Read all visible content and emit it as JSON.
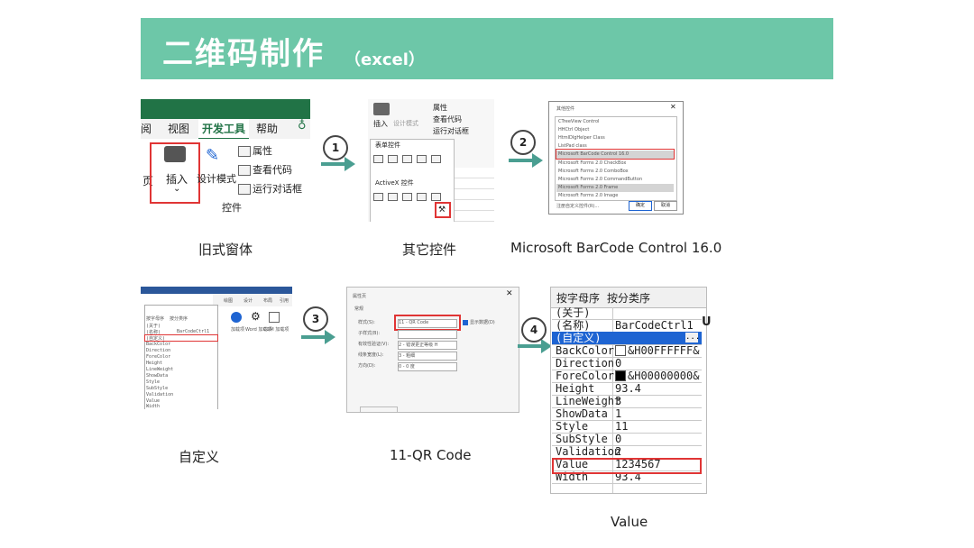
{
  "header": {
    "title": "二维码制作",
    "subtitle": "（excel）"
  },
  "captions": {
    "c1": "旧式窗体",
    "c2": "其它控件",
    "c3": "Microsoft BarCode Control 16.0",
    "c4": "自定义",
    "c5": "11-QR Code",
    "c6": "Value"
  },
  "steps": {
    "s1": "1",
    "s2": "2",
    "s3": "3",
    "s4": "4"
  },
  "ribbon": {
    "tab_view": "视图",
    "tab_dev": "开发工具",
    "tab_help": "帮助",
    "insert_label": "插入",
    "design_mode": "设计模式",
    "properties": "属性",
    "view_code": "查看代码",
    "run_dialog": "运行对话框",
    "group_controls": "控件",
    "left_label": "页"
  },
  "insert_menu": {
    "insert": "插入",
    "design": "设计模式",
    "properties": "属性",
    "view_code": "查看代码",
    "run_dialog": "运行对话框",
    "form_controls": "表单控件",
    "activex_controls": "ActiveX 控件"
  },
  "more_controls": {
    "title": "其他控件",
    "items": [
      "CTreeView Control",
      "HHCtrl Object",
      "HtmlDlgHelper Class",
      "ListPad class",
      "Microsoft BarCode Control 16.0",
      "Microsoft Forms 2.0 CheckBox",
      "Microsoft Forms 2.0 ComboBox",
      "Microsoft Forms 2.0 CommandButton",
      "Microsoft Forms 2.0 Frame",
      "Microsoft Forms 2.0 Image"
    ],
    "register": "注册自定义控件(R)...",
    "ok": "确定",
    "cancel": "取消"
  },
  "custom_shot": {
    "tabs": [
      "按字母序",
      "按分类序"
    ],
    "rows": [
      "(关于)",
      "(名称)",
      "(自定义)",
      "BackColor",
      "Direction",
      "ForeColor",
      "Height",
      "LineWeight",
      "ShowData",
      "Style",
      "SubStyle",
      "Validation",
      "Value",
      "Width"
    ],
    "name_value": "BarCodeCtrl1",
    "ribbon": [
      "绘图",
      "设计",
      "布局",
      "引用"
    ],
    "addins": [
      "加载项",
      "Word 加载项",
      "COM 加载项"
    ]
  },
  "qr_dialog": {
    "title": "属性页",
    "tab": "常规",
    "fields": [
      "样式(S):",
      "子样式(B):",
      "有效性验证(V):",
      "线条宽度(L):",
      "方向(D):"
    ],
    "values": [
      "11 - QR Code",
      "",
      "2 - 错误更正等级 H",
      "3 - 粗细",
      "0 - 0 度"
    ],
    "show_data": "显示数据(D)"
  },
  "prop_grid": {
    "tabs": [
      "按字母序",
      "按分类序"
    ],
    "rows": [
      {
        "name": "(关于)",
        "value": ""
      },
      {
        "name": "(名称)",
        "value": "BarCodeCtrl1"
      },
      {
        "name": "(自定义)",
        "value": ""
      },
      {
        "name": "BackColor",
        "value": "&H00FFFFFF&"
      },
      {
        "name": "Direction",
        "value": "0"
      },
      {
        "name": "ForeColor",
        "value": "&H00000000&"
      },
      {
        "name": "Height",
        "value": "93.4"
      },
      {
        "name": "LineWeight",
        "value": "3"
      },
      {
        "name": "ShowData",
        "value": "1"
      },
      {
        "name": "Style",
        "value": "11"
      },
      {
        "name": "SubStyle",
        "value": "0"
      },
      {
        "name": "Validation",
        "value": "2"
      },
      {
        "name": "Value",
        "value": "1234567"
      },
      {
        "name": "Width",
        "value": "93.4"
      }
    ],
    "ellipsis": "..."
  },
  "colors": {
    "banner": "#6dc7a8",
    "arrow": "#4a9e91",
    "highlight": "#e03535",
    "selection": "#1e64d2",
    "ribbon_green": "#217346"
  }
}
